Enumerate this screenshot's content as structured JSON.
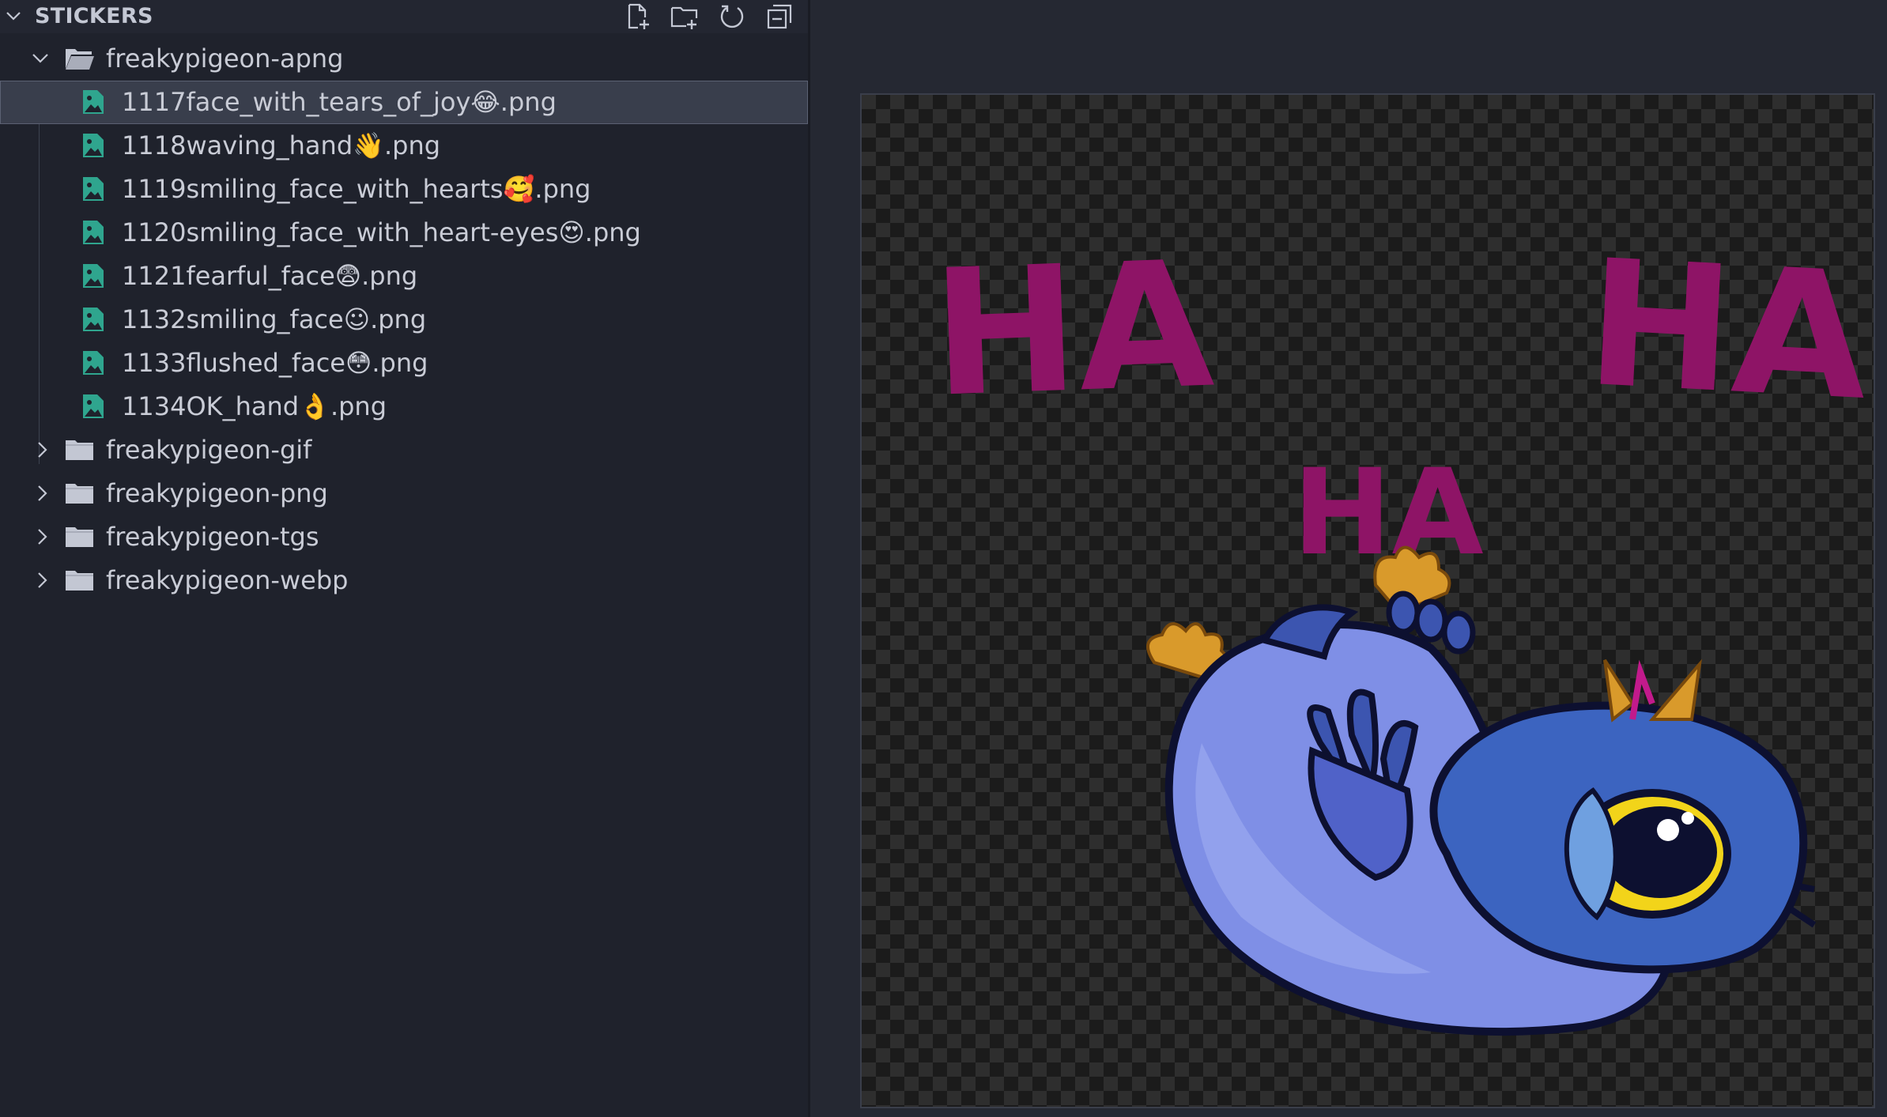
{
  "explorer": {
    "section_title": "STICKERS",
    "actions": [
      {
        "name": "new-file",
        "icon": "new-file-icon"
      },
      {
        "name": "new-folder",
        "icon": "new-folder-icon"
      },
      {
        "name": "refresh",
        "icon": "refresh-icon"
      },
      {
        "name": "collapse-all",
        "icon": "collapse-all-icon"
      }
    ],
    "root_folder": {
      "label": "freakypigeon-apng",
      "expanded": true
    },
    "files": [
      {
        "label": "1117face_with_tears_of_joy😂.png",
        "selected": true
      },
      {
        "label": "1118waving_hand👋.png"
      },
      {
        "label": "1119smiling_face_with_hearts🥰.png"
      },
      {
        "label": "1120smiling_face_with_heart-eyes😍.png"
      },
      {
        "label": "1121fearful_face😨.png"
      },
      {
        "label": "1132smiling_face☺.png"
      },
      {
        "label": "1133flushed_face😳.png"
      },
      {
        "label": "1134OK_hand👌.png"
      }
    ],
    "folders": [
      {
        "label": "freakypigeon-gif"
      },
      {
        "label": "freakypigeon-png"
      },
      {
        "label": "freakypigeon-tgs"
      },
      {
        "label": "freakypigeon-webp"
      }
    ]
  },
  "preview": {
    "image_text": [
      "HA",
      "HA",
      "HA"
    ],
    "colors": {
      "ha": "#8e1466",
      "pigeon_body": "#7f8fe6",
      "pigeon_dark": "#3c55b0",
      "outline": "#0d1030",
      "claws": "#d99a2b",
      "eye": "#f2d41a"
    }
  },
  "colors": {
    "file_icon": "#2fa58e",
    "folder_icon": "#c3c7d3",
    "text": "#c9ccd6",
    "selection": "#393e4c"
  }
}
